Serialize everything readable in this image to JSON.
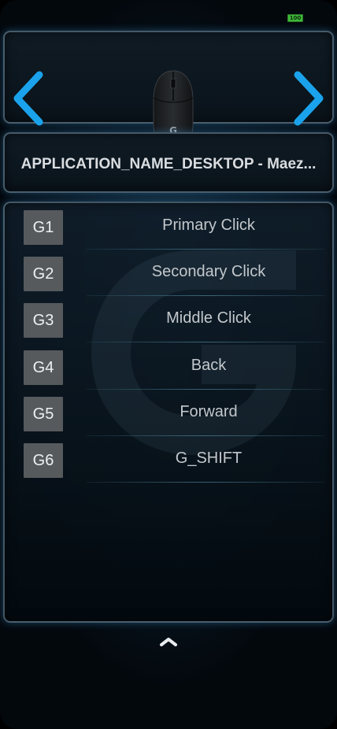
{
  "status_bar": {
    "battery": "100"
  },
  "device": {
    "icon": "gaming-mouse-icon"
  },
  "application": {
    "name": "APPLICATION_NAME_DESKTOP - Maez..."
  },
  "assignments": [
    {
      "key": "G1",
      "action": "Primary Click"
    },
    {
      "key": "G2",
      "action": "Secondary Click"
    },
    {
      "key": "G3",
      "action": "Middle Click"
    },
    {
      "key": "G4",
      "action": "Back"
    },
    {
      "key": "G5",
      "action": "Forward"
    },
    {
      "key": "G6",
      "action": "G_SHIFT"
    }
  ],
  "colors": {
    "accent": "#1aa3ec",
    "key_bg": "#565a5d",
    "battery": "#3fb93a"
  }
}
